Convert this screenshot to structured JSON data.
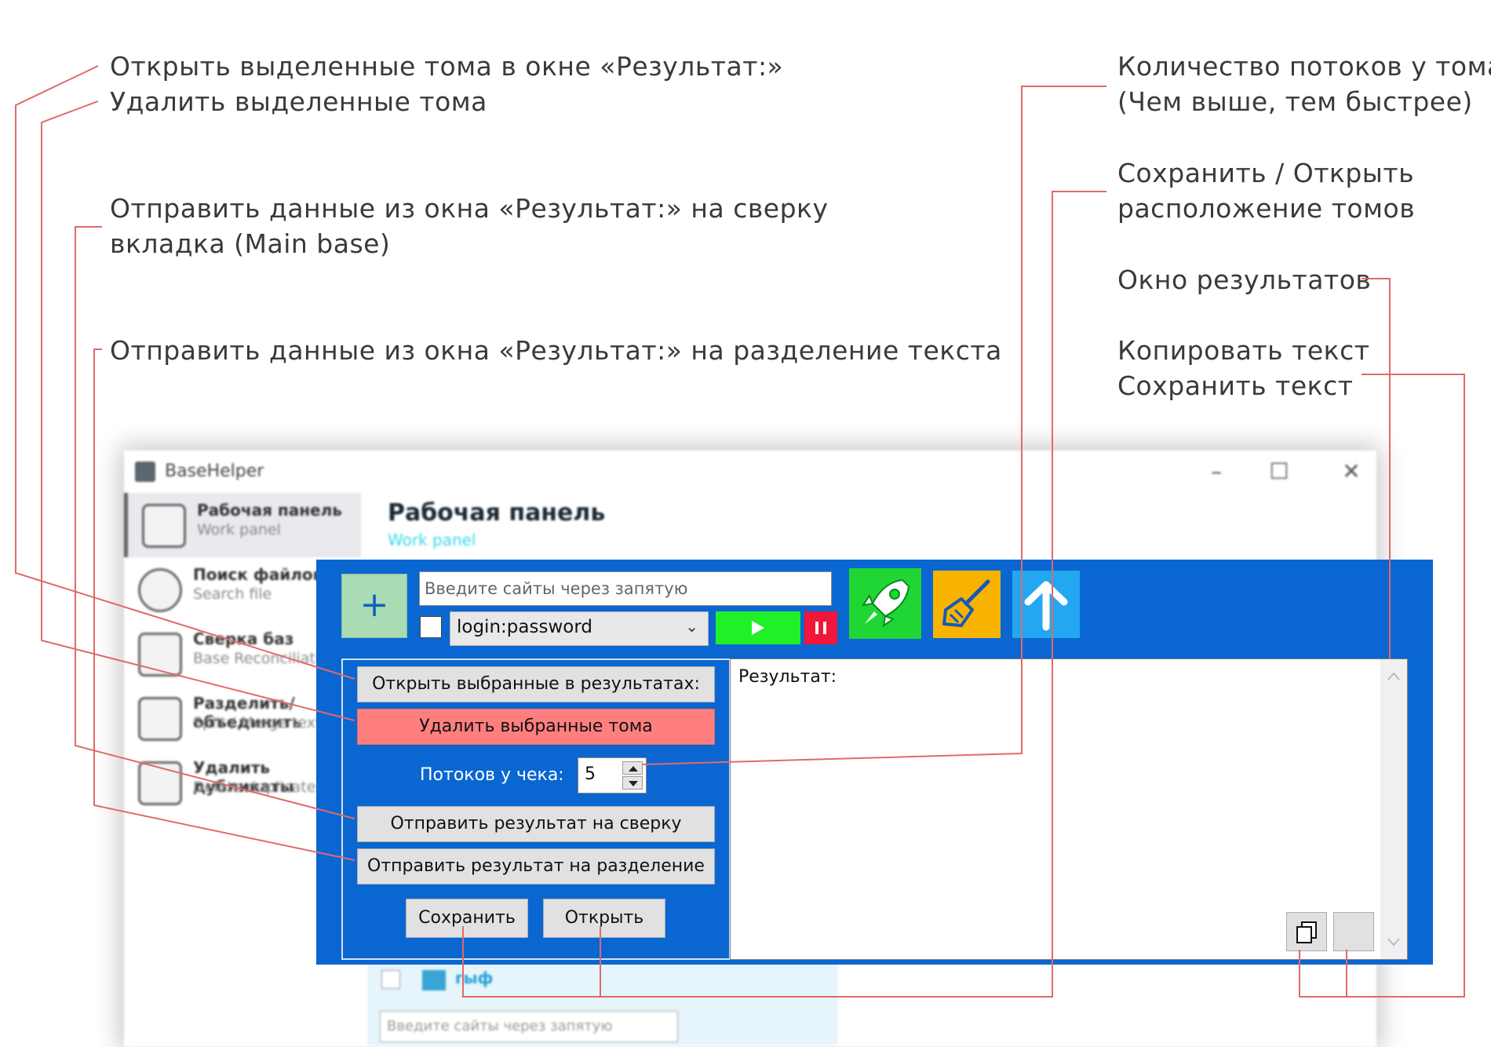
{
  "annotations": {
    "left_1": "Открыть выделенные тома в окне «Результат:»",
    "left_2": "Удалить выделенные тома",
    "left_3a": "Отправить данные из окна «Результат:» на сверку",
    "left_3b": "вкладка (Main base)",
    "left_4": "Отправить данные из окна «Результат:» на разделение текста",
    "right_1a": "Количество потоков у тома",
    "right_1b": "(Чем выше, тем быстрее)",
    "right_2a": "Сохранить / Открыть",
    "right_2b": "расположение томов",
    "right_3": "Окно результатов",
    "right_4a": "Копировать текст",
    "right_4b": "Сохранить текст"
  },
  "window": {
    "title": "BaseHelper",
    "minimize": "–",
    "maximize": "☐",
    "close": "✕"
  },
  "sidebar": {
    "items": [
      {
        "title": "Рабочая панель",
        "subtitle": "Work panel"
      },
      {
        "title": "Поиск файлов",
        "subtitle": "Search file"
      },
      {
        "title": "Сверка баз",
        "subtitle": "Base Reconciliation"
      },
      {
        "title": "Разделить/объединить",
        "subtitle": "Split / Merge text"
      },
      {
        "title": "Удалить дубликаты",
        "subtitle": "Delete duplicates"
      }
    ]
  },
  "main": {
    "title": "Рабочая панель",
    "subtitle": "Work panel"
  },
  "panel": {
    "add_label": "+",
    "sites_placeholder": "Введите сайты через запятую",
    "format_selected": "login:password",
    "threads_label": "Потоков у чека:",
    "threads_value": "5",
    "open_selected_label": "Открыть выбранные в результатах:",
    "delete_selected_label": "Удалить выбранные тома",
    "send_reconcile_label": "Отправить результат на сверку",
    "send_split_label": "Отправить результат на разделение",
    "save_label": "Сохранить",
    "open_label": "Открыть",
    "result_label": "Результат:"
  },
  "ghost_row": {
    "name": "гыф",
    "sites_placeholder": "Введите сайты через запятую"
  },
  "colors": {
    "panel_blue": "#0a66d1",
    "rocket_green": "#1fd634",
    "broom_orange": "#f7b300",
    "arrow_blue": "#22a7f0",
    "delete_red": "#ff7f7f",
    "annotation_line": "#e06a6a"
  },
  "icons": {
    "rocket": "rocket-icon",
    "broom": "broom-icon",
    "arrow": "arrow-up-icon",
    "copy": "copy-icon"
  }
}
